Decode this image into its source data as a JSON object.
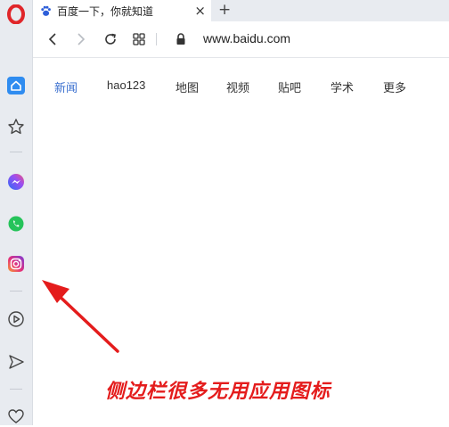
{
  "browser": {
    "tab_title": "百度一下，你就知道",
    "tab_close": "×",
    "new_tab": "+",
    "url": "www.baidu.com"
  },
  "sidebar": {
    "icons": [
      "opera-logo-icon",
      "home-icon",
      "star-icon",
      "messenger-icon",
      "whatsapp-icon",
      "instagram-icon",
      "play-circle-icon",
      "send-icon",
      "heart-icon"
    ]
  },
  "baidu_nav": {
    "links": [
      "新闻",
      "hao123",
      "地图",
      "视频",
      "贴吧",
      "学术",
      "更多"
    ]
  },
  "annotation": {
    "text": "侧边栏很多无用应用图标",
    "color": "#e41c1c"
  },
  "colors": {
    "accent_blue": "#3a6fcf",
    "sidebar_bg": "#e8ebf0",
    "opera_red": "#e0262a"
  }
}
